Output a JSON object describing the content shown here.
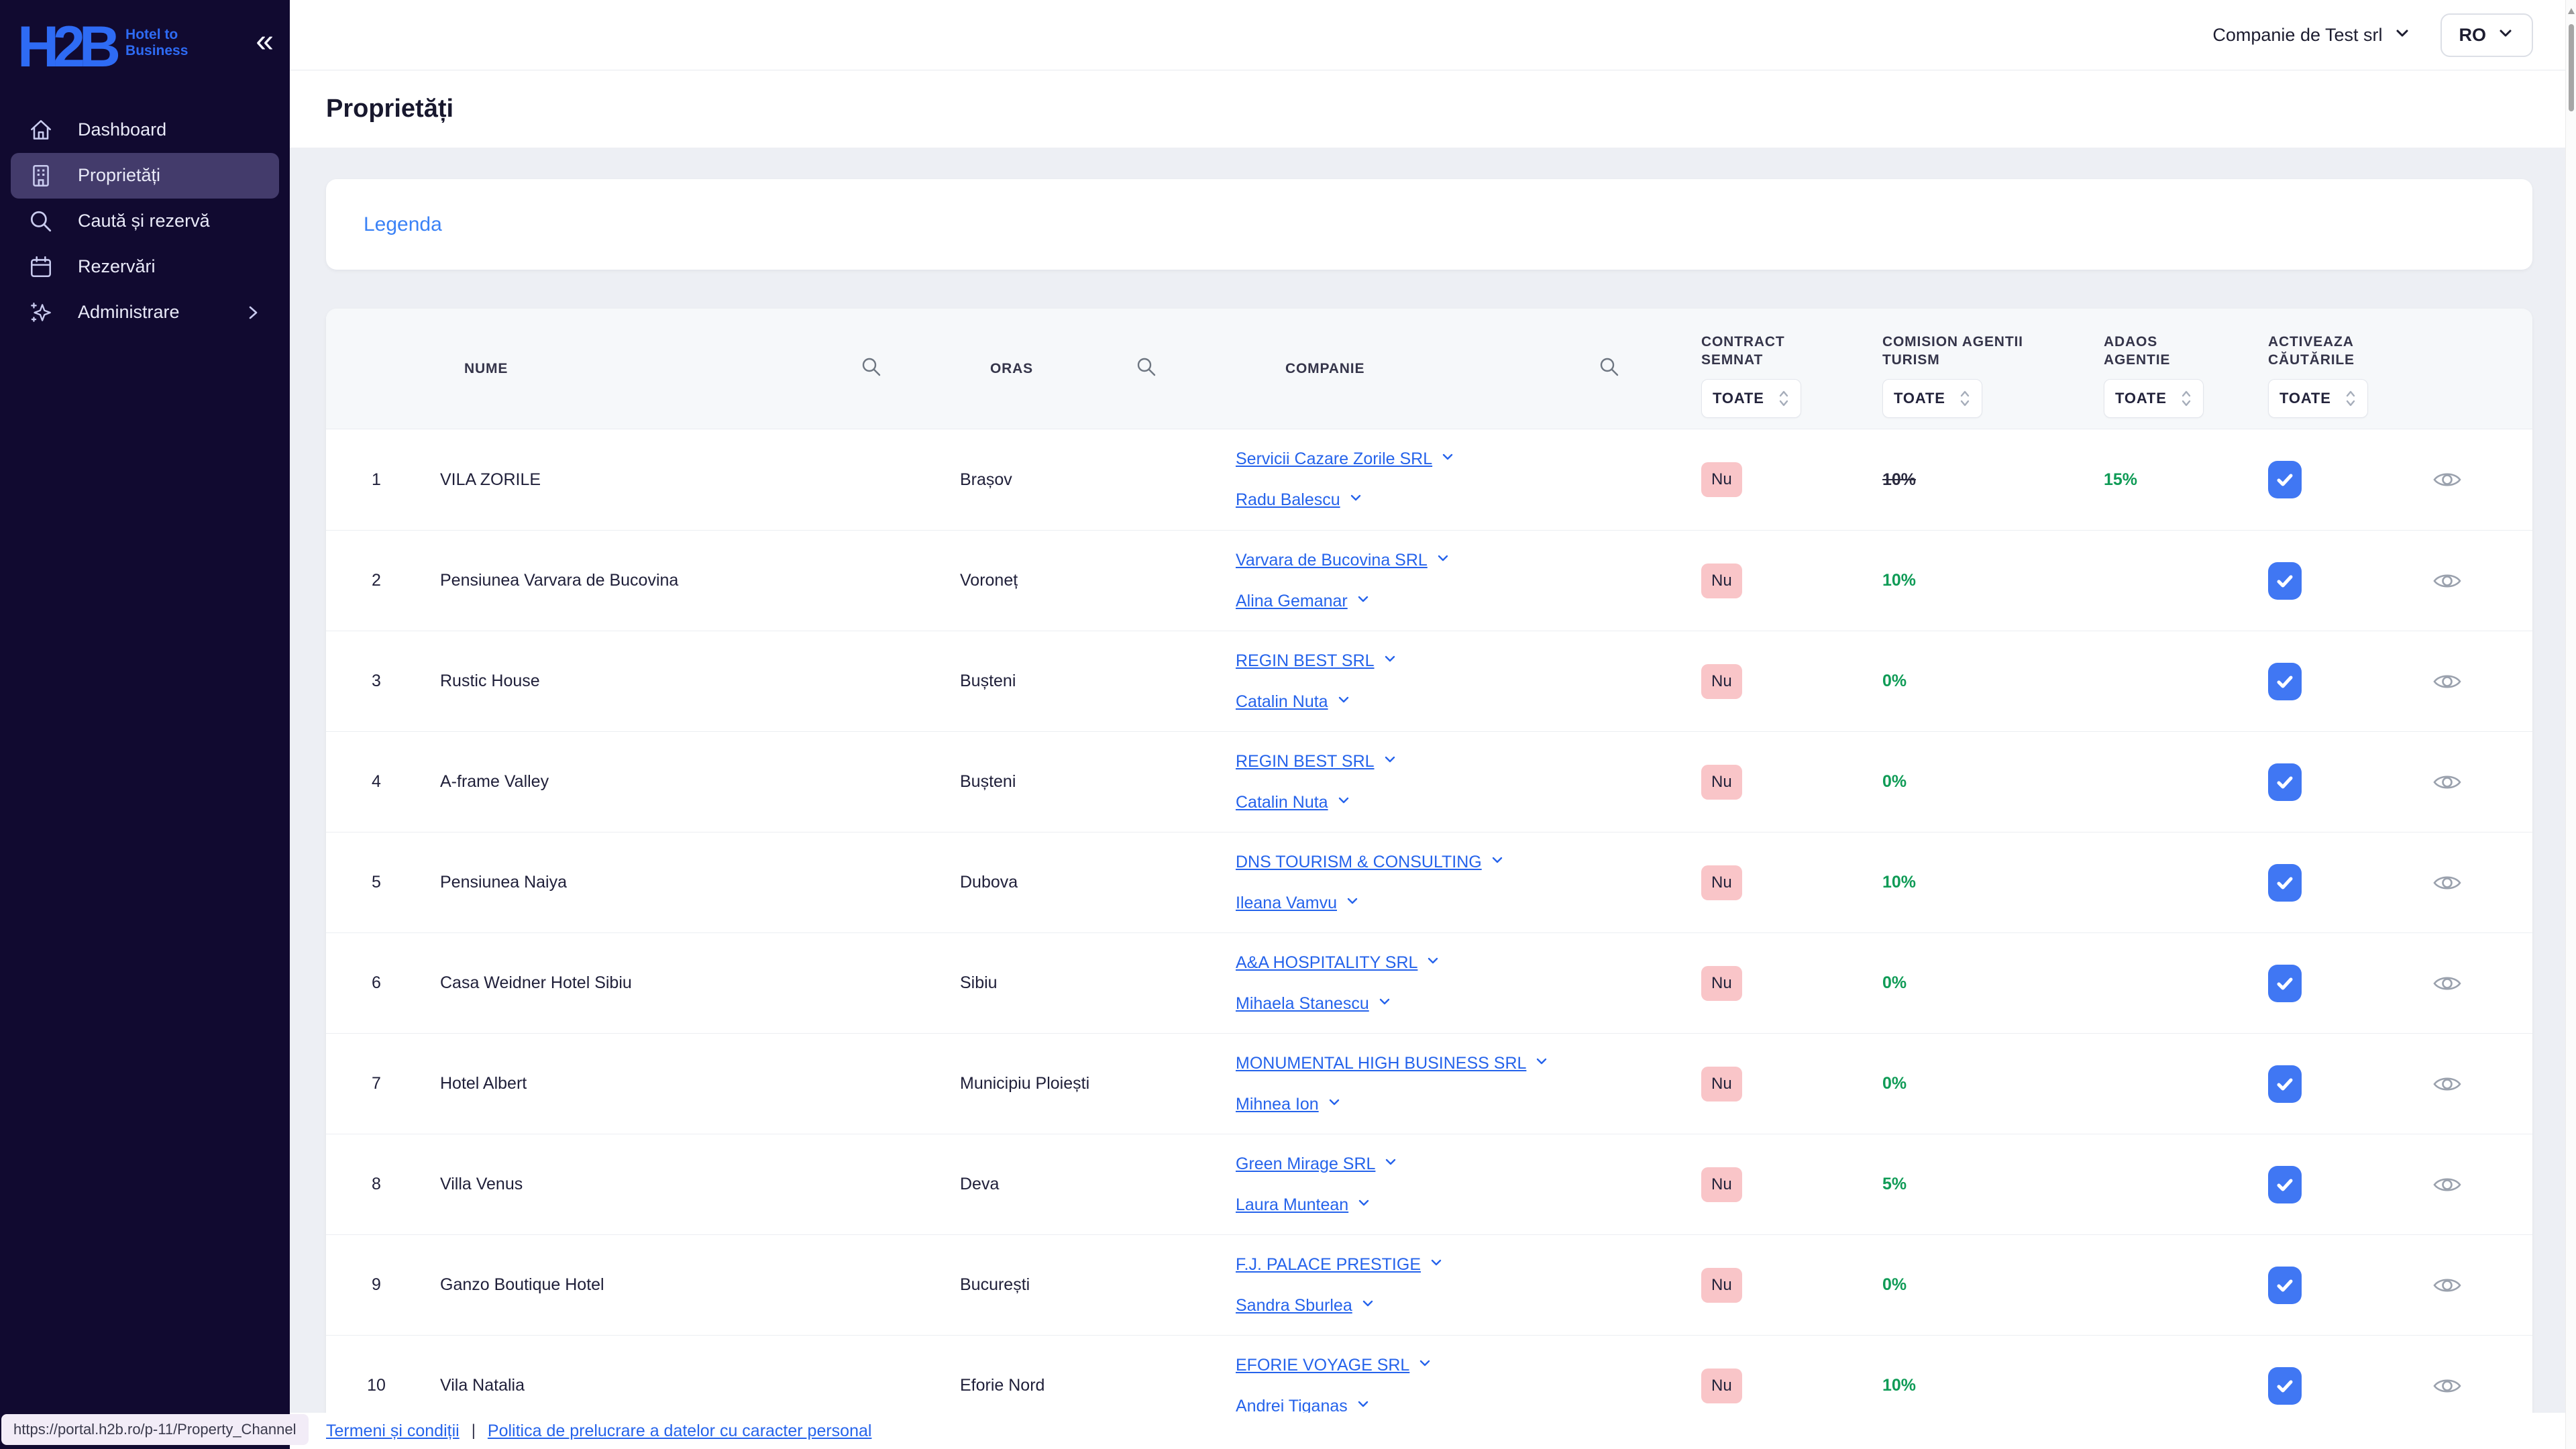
{
  "brand": {
    "logo": "H2B",
    "tagline_line1": "Hotel to",
    "tagline_line2": "Business"
  },
  "topbar": {
    "company": "Companie de Test srl",
    "language": "RO"
  },
  "sidebar": {
    "items": [
      {
        "label": "Dashboard",
        "icon": "home",
        "active": false,
        "has_submenu": false
      },
      {
        "label": "Proprietăți",
        "icon": "building",
        "active": true,
        "has_submenu": false
      },
      {
        "label": "Caută și rezervă",
        "icon": "search",
        "active": false,
        "has_submenu": false
      },
      {
        "label": "Rezervări",
        "icon": "calendar",
        "active": false,
        "has_submenu": false
      },
      {
        "label": "Administrare",
        "icon": "sparkles",
        "active": false,
        "has_submenu": true
      }
    ]
  },
  "page": {
    "title": "Proprietăți",
    "legend_title": "Legenda"
  },
  "table": {
    "headers": {
      "nume": "NUME",
      "oras": "ORAS",
      "companie": "COMPANIE",
      "contract_semnat": "CONTRACT SEMNAT",
      "comision": "COMISION AGENTII TURISM",
      "adaos": "ADAOS AGENTIE",
      "activeaza": "ACTIVEAZA CĂUTĂRILE"
    },
    "filter_value": "TOATE",
    "rows": [
      {
        "index": 1,
        "name": "VILA ZORILE",
        "city": "Brașov",
        "company": "Servicii Cazare Zorile SRL",
        "contact": "Radu Balescu",
        "contract": "Nu",
        "comision": "10%",
        "comision_struck": true,
        "adaos": "15%",
        "active": true
      },
      {
        "index": 2,
        "name": "Pensiunea Varvara de Bucovina",
        "city": "Voroneț",
        "company": "Varvara de Bucovina SRL",
        "contact": "Alina Gemanar",
        "contract": "Nu",
        "comision": "10%",
        "comision_struck": false,
        "adaos": "",
        "active": true
      },
      {
        "index": 3,
        "name": "Rustic House",
        "city": "Bușteni",
        "company": "REGIN BEST SRL",
        "contact": "Catalin Nuta",
        "contract": "Nu",
        "comision": "0%",
        "comision_struck": false,
        "adaos": "",
        "active": true
      },
      {
        "index": 4,
        "name": "A-frame Valley",
        "city": "Bușteni",
        "company": "REGIN BEST SRL",
        "contact": "Catalin Nuta",
        "contract": "Nu",
        "comision": "0%",
        "comision_struck": false,
        "adaos": "",
        "active": true
      },
      {
        "index": 5,
        "name": "Pensiunea Naiya",
        "city": "Dubova",
        "company": "DNS TOURISM & CONSULTING",
        "contact": "Ileana Vamvu",
        "contract": "Nu",
        "comision": "10%",
        "comision_struck": false,
        "adaos": "",
        "active": true
      },
      {
        "index": 6,
        "name": "Casa Weidner Hotel Sibiu",
        "city": "Sibiu",
        "company": "A&A HOSPITALITY SRL",
        "contact": "Mihaela Stanescu",
        "contract": "Nu",
        "comision": "0%",
        "comision_struck": false,
        "adaos": "",
        "active": true
      },
      {
        "index": 7,
        "name": "Hotel Albert",
        "city": "Municipiu Ploiești",
        "company": "MONUMENTAL HIGH BUSINESS SRL",
        "contact": "Mihnea Ion",
        "contract": "Nu",
        "comision": "0%",
        "comision_struck": false,
        "adaos": "",
        "active": true
      },
      {
        "index": 8,
        "name": "Villa Venus",
        "city": "Deva",
        "company": "Green Mirage SRL",
        "contact": "Laura Muntean",
        "contract": "Nu",
        "comision": "5%",
        "comision_struck": false,
        "adaos": "",
        "active": true
      },
      {
        "index": 9,
        "name": "Ganzo Boutique Hotel",
        "city": "București",
        "company": "F.J. PALACE PRESTIGE",
        "contact": "Sandra Sburlea",
        "contract": "Nu",
        "comision": "0%",
        "comision_struck": false,
        "adaos": "",
        "active": true
      },
      {
        "index": 10,
        "name": "Vila Natalia",
        "city": "Eforie Nord",
        "company": "EFORIE VOYAGE SRL",
        "contact": "Andrei Tiganas",
        "contract": "Nu",
        "comision": "10%",
        "comision_struck": false,
        "adaos": "",
        "active": true
      }
    ]
  },
  "footer": {
    "link1": "Termeni și condiții",
    "separator": "|",
    "link2": "Politica de prelucrare a datelor cu caracter personal"
  },
  "status_url": "https://portal.h2b.ro/p-11/Property_Channel",
  "colors": {
    "accent_blue": "#2e6bf4",
    "link_blue": "#2563eb",
    "green": "#0f9b56",
    "badge_pink": "#f9c5c8",
    "sidebar_bg": "#110a30",
    "active_item_bg": "#433b6b",
    "checkbox_blue": "#4077f3"
  }
}
